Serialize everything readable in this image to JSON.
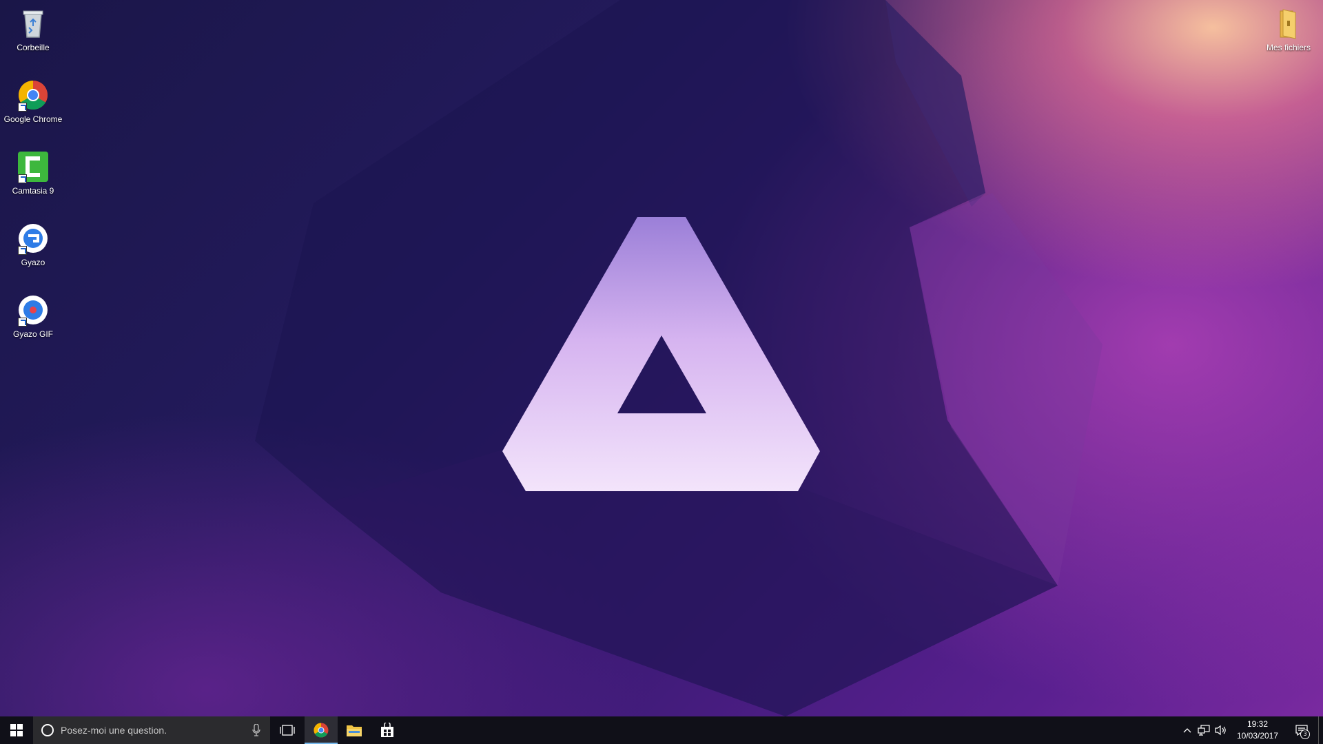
{
  "desktop": {
    "icons_left": [
      {
        "label": "Corbeille",
        "icon": "recycle-bin-icon"
      },
      {
        "label": "Google Chrome",
        "icon": "chrome-icon"
      },
      {
        "label": "Camtasia 9",
        "icon": "camtasia-icon"
      },
      {
        "label": "Gyazo",
        "icon": "gyazo-icon"
      },
      {
        "label": "Gyazo GIF",
        "icon": "gyazo-gif-icon"
      }
    ],
    "icon_right": {
      "label": "Mes fichiers",
      "icon": "folder-icon"
    }
  },
  "taskbar": {
    "search_placeholder": "Posez-moi une question.",
    "pinned_apps": [
      "chrome-icon",
      "file-explorer-icon",
      "store-icon"
    ],
    "active_app": "chrome-icon",
    "clock": {
      "time": "19:32",
      "date": "10/03/2017"
    },
    "notification_count": "3"
  },
  "colors": {
    "taskbar_bg": "#101018",
    "search_bg": "#2b2b2e",
    "active_indicator": "#76b9ed",
    "logo_top": "#9b7fd8",
    "logo_bottom": "#f3e4fb"
  }
}
